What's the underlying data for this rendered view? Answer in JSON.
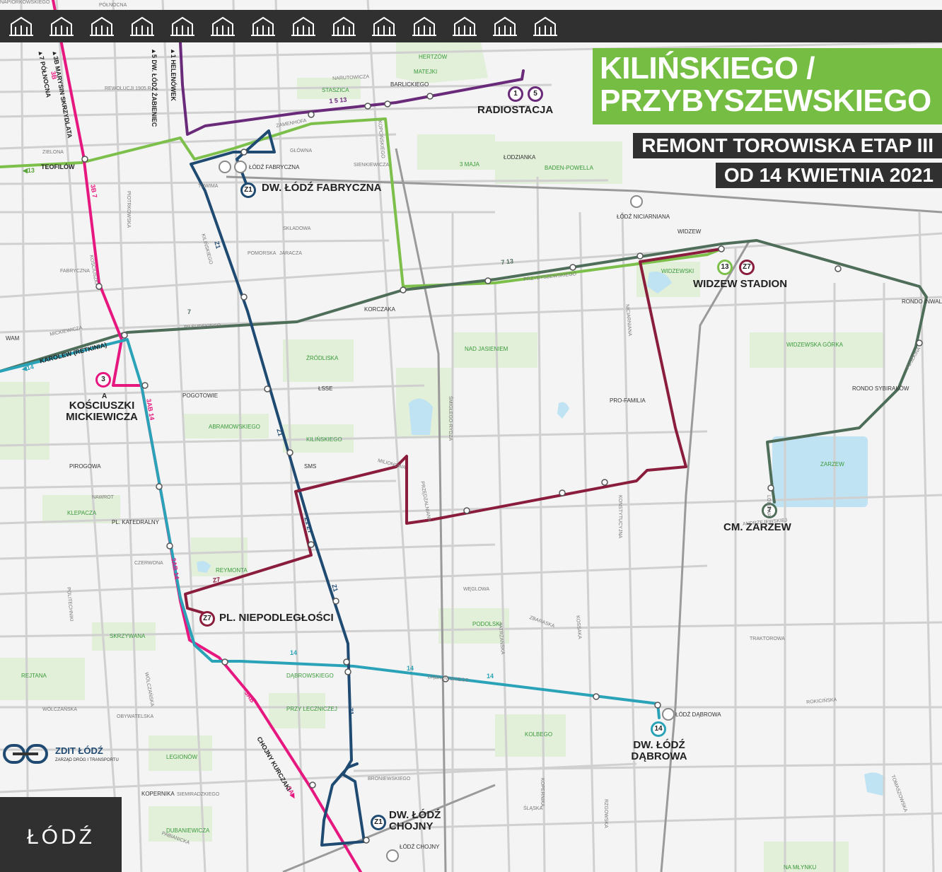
{
  "title": {
    "line1": "KILIŃSKIEGO /",
    "line2": "PRZYBYSZEWSKIEGO",
    "subtitle1": "REMONT TOROWISKA ETAP III",
    "subtitle2": "OD 14 KWIETNIA 2021"
  },
  "landmark_icons": [
    "station-icon",
    "bridge-icon",
    "monument-icon",
    "factory-icon",
    "arena-icon",
    "palace-icon",
    "building-icon",
    "leaf-icon",
    "church-icon",
    "chair-icon",
    "villa-icon",
    "arches-icon",
    "tower-icon",
    "gate-icon"
  ],
  "terminals": {
    "radiostacja": "RADIOSTACJA",
    "fabryczna": "DW. ŁÓDŹ FABRYCZNA",
    "widzew": "WIDZEW STADION",
    "kosciuszki1": "KOŚCIUSZKI",
    "kosciuszki2": "MICKIEWICZA",
    "kosciuszki_a": "A",
    "niepodleglosci": "PL. NIEPODLEGŁOŚCI",
    "zarzew": "CM. ZARZEW",
    "dabrowa1": "DW. ŁÓDŹ",
    "dabrowa2": "DĄBROWA",
    "chojny1": "DW. ŁÓDŹ",
    "chojny2": "CHOJNY"
  },
  "badges": {
    "b1": "1",
    "b5": "5",
    "z1a": "Z1",
    "b13": "13",
    "z7a": "Z7",
    "b3": "3",
    "z7b": "Z7",
    "b7": "7",
    "b14": "14",
    "z1b": "Z1"
  },
  "places": [
    "HERTZÓW",
    "MATEJKI",
    "BARLICKIEGO",
    "STASZICA",
    "ŁÓDŹ FABRYCZNA",
    "3 MAJA",
    "ŁODZIANKA",
    "BADEN-POWELLA",
    "ŁÓDŹ NICIARNIANA",
    "WIDZEW",
    "WIDZEWSKI",
    "KORCZAKA",
    "NAD JASIENIEM",
    "WIDZEWSKA GÓRKA",
    "ŹRÓDLISKA",
    "ŁSSE",
    "WAM",
    "POGOTOWIE",
    "ABRAMOWSKIEGO",
    "KILIŃSKIEGO",
    "SMS",
    "PRO-FAMILIA",
    "PIROGOWA",
    "KLEPACZA",
    "PL. KATEDRALNY",
    "ZARZEW",
    "REYMONTA",
    "PODOLSKI",
    "SKRZYWANA",
    "DĄBROWSKIEGO",
    "PRZY LECZNICZEJ",
    "REJTANA",
    "KOLBEGO",
    "ŁÓDŹ DĄBROWA",
    "LEGIONÓW",
    "KOPERNIKA",
    "DUBANIEWICZA",
    "ŁÓDŹ CHOJNY",
    "NA MŁYNKU",
    "RONDO INWALIDÓW",
    "RONDO SYBIRAKÓW"
  ],
  "streets": [
    "PÓŁNOCNA",
    "REWOLUCJI 1905 R.",
    "NARUTOWICZA",
    "ZIELONA",
    "PIOTRKOWSKA",
    "KOŚCIUSZKI",
    "KILIŃSKIEGO",
    "POMORSKA",
    "PIŁSUDSKIEGO",
    "MICKIEWICZA",
    "PRZYBYSZEWSKIEGO",
    "MILIONOWA",
    "DĄBROWSKIEGO",
    "ŚMIGŁEGO-RYDZA",
    "NICIARNIANA",
    "LODOWA",
    "PUSZKINA",
    "ANDRZEJEWSKIEJ",
    "TRAKTOROWA",
    "WÓLCZAŃSKA",
    "POLITECHNIKI",
    "ROKICIŃSKA",
    "TOMASZOWSKA",
    "ŚLĄSKA",
    "RZGOWSKA",
    "PABIANICKA",
    "TUWIMA",
    "JARACZA",
    "KOPCIŃSKIEGO",
    "PRZĘDZALNIANA",
    "WĘGLOWA",
    "BRONIEWSKIEGO",
    "TATRZAŃSKA",
    "KOSSAKA",
    "ZBARASKA",
    "SIENKIEWICZA",
    "SKŁADOWA",
    "GŁÓWNA",
    "FABRYCZNA",
    "ZAMENHOFA",
    "NAWROT",
    "CZERWONA",
    "WÓLCZAŃSKA",
    "OBYWATELSKA",
    "SIEMIRADZKIEGO",
    "KOPERNIKA",
    "KONSTYTUCYJNA",
    "NAPIÓRKOWSKIEGO"
  ],
  "line_labels": {
    "l1_5_13": "1  5 13",
    "l13_zielona": "◀13",
    "teofilow": "TEOFILÓW",
    "l7_13": "7  13",
    "l7": "7",
    "l14_karolew": "◀14",
    "karolew": "KAROLEW (RETKINIA)",
    "l3b": "3B",
    "l3b7": "3B  7",
    "l3ab14": "3AB  14",
    "l3ab14b": "3AB  14",
    "l3ab": "3AB",
    "l3a": "3A▶",
    "chojny_kurczaki": "CHOJNY KURCZAKI",
    "l14a": "14",
    "l14b": "14",
    "l14c": "14",
    "lz1a": "Z1",
    "lz1b": "Z1",
    "lz1z7": "Z1 Z7",
    "lz1c": "Z1",
    "lz1d": "Z1",
    "lz7": "Z7",
    "helenowek": "▲1 HELENÓWEK",
    "zabieniec": "▲5 DW. ŁÓDŹ ŻABIENIEC",
    "marysin": "▲3B MARYSIN SKRZYDLATA",
    "polnocna": "▲7 PÓŁNOCNA"
  },
  "logo": {
    "zdit": "ZDIT ŁÓDŹ",
    "zdit_sub": "ZARZĄD DRÓG I TRANSPORTU",
    "city": "ŁÓDŹ"
  },
  "colors": {
    "line1_5": "#6a2a7a",
    "line13": "#7cbf4a",
    "line7": "#4f6e5a",
    "line3": "#e6187f",
    "line14": "#2aa3b8",
    "z1": "#1f4a72",
    "z7": "#8a1c3c",
    "green_title": "#76bd43",
    "dark": "#303030"
  }
}
